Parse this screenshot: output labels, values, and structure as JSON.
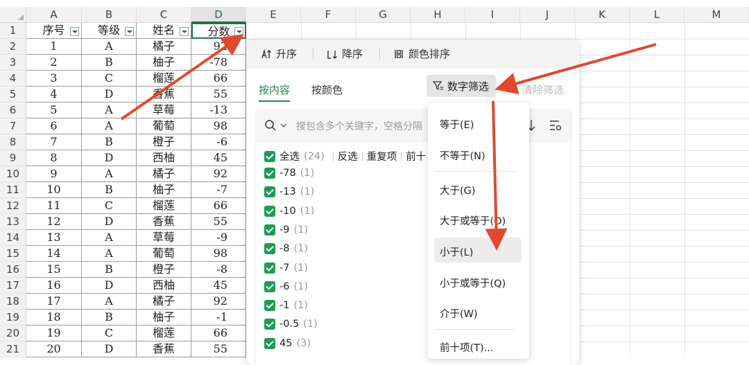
{
  "sheet": {
    "columns": [
      "A",
      "B",
      "C",
      "D",
      "E",
      "F",
      "G",
      "H",
      "I",
      "J",
      "K",
      "L",
      "M"
    ],
    "row_numbers": [
      "1",
      "2",
      "3",
      "4",
      "5",
      "6",
      "7",
      "8",
      "9",
      "10",
      "11",
      "12",
      "13",
      "14",
      "15",
      "16",
      "17",
      "18",
      "19",
      "20",
      "21"
    ],
    "headers": [
      "序号",
      "等级",
      "姓名",
      "分数"
    ],
    "rows": [
      [
        "1",
        "A",
        "橘子",
        "92"
      ],
      [
        "2",
        "B",
        "柚子",
        "-78"
      ],
      [
        "3",
        "C",
        "榴莲",
        "66"
      ],
      [
        "4",
        "D",
        "香蕉",
        "55"
      ],
      [
        "5",
        "A",
        "草莓",
        "-13"
      ],
      [
        "6",
        "A",
        "葡萄",
        "98"
      ],
      [
        "7",
        "B",
        "橙子",
        "-6"
      ],
      [
        "8",
        "D",
        "西柚",
        "45"
      ],
      [
        "9",
        "A",
        "橘子",
        "92"
      ],
      [
        "10",
        "B",
        "柚子",
        "-7"
      ],
      [
        "11",
        "C",
        "榴莲",
        "66"
      ],
      [
        "12",
        "D",
        "香蕉",
        "55"
      ],
      [
        "13",
        "A",
        "草莓",
        "-9"
      ],
      [
        "14",
        "A",
        "葡萄",
        "98"
      ],
      [
        "15",
        "B",
        "橙子",
        "-8"
      ],
      [
        "16",
        "D",
        "西柚",
        "45"
      ],
      [
        "17",
        "A",
        "橘子",
        "92"
      ],
      [
        "18",
        "B",
        "柚子",
        "-1"
      ],
      [
        "19",
        "C",
        "榴莲",
        "66"
      ],
      [
        "20",
        "D",
        "香蕉",
        "55"
      ]
    ]
  },
  "panel": {
    "sort_asc": "升序",
    "sort_desc": "降序",
    "sort_color": "颜色排序",
    "tab_content": "按内容",
    "tab_color": "按颜色",
    "number_filter": "数字筛选",
    "clear_filter": "清除筛选",
    "search_placeholder": "搜包含多个关键字，空格分隔",
    "select_all": "全选",
    "select_all_count": "(24)",
    "invert": "反选",
    "duplicates": "重复项",
    "top10": "前十",
    "values": [
      {
        "label": "-78",
        "count": "(1)"
      },
      {
        "label": "-13",
        "count": "(1)"
      },
      {
        "label": "-10",
        "count": "(1)"
      },
      {
        "label": "-9",
        "count": "(1)"
      },
      {
        "label": "-8",
        "count": "(1)"
      },
      {
        "label": "-7",
        "count": "(1)"
      },
      {
        "label": "-6",
        "count": "(1)"
      },
      {
        "label": "-1",
        "count": "(1)"
      },
      {
        "label": "-0.5",
        "count": "(1)"
      },
      {
        "label": "45",
        "count": "(3)"
      }
    ]
  },
  "menu": {
    "items": [
      "等于(E)",
      "不等于(N)",
      "大于(G)",
      "大于或等于(O)",
      "小于(L)",
      "小于或等于(Q)",
      "介于(W)",
      "前十项(T)..."
    ]
  },
  "colors": {
    "accent": "#1b8a4a",
    "arrow": "#e0492e"
  }
}
